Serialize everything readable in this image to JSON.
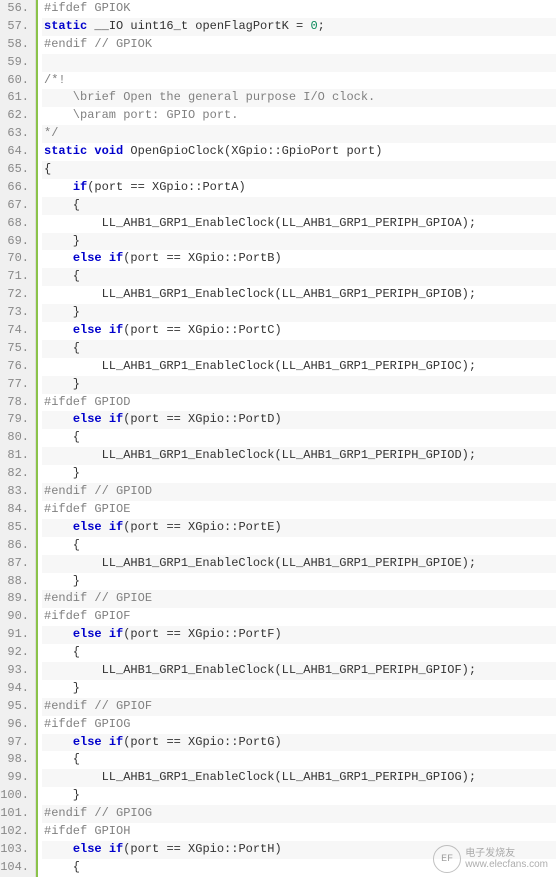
{
  "startLine": 56,
  "lines": [
    [
      [
        "pp",
        "#ifdef GPIOK"
      ]
    ],
    [
      [
        "kw",
        "static"
      ],
      [
        "id",
        " __IO uint16_t openFlagPortK = "
      ],
      [
        "num",
        "0"
      ],
      [
        "id",
        ";"
      ]
    ],
    [
      [
        "pp",
        "#endif // GPIOK"
      ]
    ],
    [
      [
        "id",
        ""
      ]
    ],
    [
      [
        "cm",
        "/*!"
      ]
    ],
    [
      [
        "cm",
        "    \\brief Open the general purpose I/O clock."
      ]
    ],
    [
      [
        "cm",
        "    \\param port: GPIO port."
      ]
    ],
    [
      [
        "cm",
        "*/"
      ]
    ],
    [
      [
        "kw",
        "static void"
      ],
      [
        "id",
        " OpenGpioClock(XGpio::GpioPort port)"
      ]
    ],
    [
      [
        "id",
        "{"
      ]
    ],
    [
      [
        "id",
        "    "
      ],
      [
        "kw",
        "if"
      ],
      [
        "id",
        "(port == XGpio::PortA)"
      ]
    ],
    [
      [
        "id",
        "    {"
      ]
    ],
    [
      [
        "id",
        "        LL_AHB1_GRP1_EnableClock(LL_AHB1_GRP1_PERIPH_GPIOA);"
      ]
    ],
    [
      [
        "id",
        "    }"
      ]
    ],
    [
      [
        "id",
        "    "
      ],
      [
        "kw",
        "else if"
      ],
      [
        "id",
        "(port == XGpio::PortB)"
      ]
    ],
    [
      [
        "id",
        "    {"
      ]
    ],
    [
      [
        "id",
        "        LL_AHB1_GRP1_EnableClock(LL_AHB1_GRP1_PERIPH_GPIOB);"
      ]
    ],
    [
      [
        "id",
        "    }"
      ]
    ],
    [
      [
        "id",
        "    "
      ],
      [
        "kw",
        "else if"
      ],
      [
        "id",
        "(port == XGpio::PortC)"
      ]
    ],
    [
      [
        "id",
        "    {"
      ]
    ],
    [
      [
        "id",
        "        LL_AHB1_GRP1_EnableClock(LL_AHB1_GRP1_PERIPH_GPIOC);"
      ]
    ],
    [
      [
        "id",
        "    }"
      ]
    ],
    [
      [
        "pp",
        "#ifdef GPIOD"
      ]
    ],
    [
      [
        "id",
        "    "
      ],
      [
        "kw",
        "else if"
      ],
      [
        "id",
        "(port == XGpio::PortD)"
      ]
    ],
    [
      [
        "id",
        "    {"
      ]
    ],
    [
      [
        "id",
        "        LL_AHB1_GRP1_EnableClock(LL_AHB1_GRP1_PERIPH_GPIOD);"
      ]
    ],
    [
      [
        "id",
        "    }"
      ]
    ],
    [
      [
        "pp",
        "#endif // GPIOD"
      ]
    ],
    [
      [
        "pp",
        "#ifdef GPIOE"
      ]
    ],
    [
      [
        "id",
        "    "
      ],
      [
        "kw",
        "else if"
      ],
      [
        "id",
        "(port == XGpio::PortE)"
      ]
    ],
    [
      [
        "id",
        "    {"
      ]
    ],
    [
      [
        "id",
        "        LL_AHB1_GRP1_EnableClock(LL_AHB1_GRP1_PERIPH_GPIOE);"
      ]
    ],
    [
      [
        "id",
        "    }"
      ]
    ],
    [
      [
        "pp",
        "#endif // GPIOE"
      ]
    ],
    [
      [
        "pp",
        "#ifdef GPIOF"
      ]
    ],
    [
      [
        "id",
        "    "
      ],
      [
        "kw",
        "else if"
      ],
      [
        "id",
        "(port == XGpio::PortF)"
      ]
    ],
    [
      [
        "id",
        "    {"
      ]
    ],
    [
      [
        "id",
        "        LL_AHB1_GRP1_EnableClock(LL_AHB1_GRP1_PERIPH_GPIOF);"
      ]
    ],
    [
      [
        "id",
        "    }"
      ]
    ],
    [
      [
        "pp",
        "#endif // GPIOF"
      ]
    ],
    [
      [
        "pp",
        "#ifdef GPIOG"
      ]
    ],
    [
      [
        "id",
        "    "
      ],
      [
        "kw",
        "else if"
      ],
      [
        "id",
        "(port == XGpio::PortG)"
      ]
    ],
    [
      [
        "id",
        "    {"
      ]
    ],
    [
      [
        "id",
        "        LL_AHB1_GRP1_EnableClock(LL_AHB1_GRP1_PERIPH_GPIOG);"
      ]
    ],
    [
      [
        "id",
        "    }"
      ]
    ],
    [
      [
        "pp",
        "#endif // GPIOG"
      ]
    ],
    [
      [
        "pp",
        "#ifdef GPIOH"
      ]
    ],
    [
      [
        "id",
        "    "
      ],
      [
        "kw",
        "else if"
      ],
      [
        "id",
        "(port == XGpio::PortH)"
      ]
    ],
    [
      [
        "id",
        "    {"
      ]
    ]
  ],
  "watermark": {
    "logo": "EF",
    "line1": "电子发烧友",
    "line2": "www.elecfans.com"
  }
}
